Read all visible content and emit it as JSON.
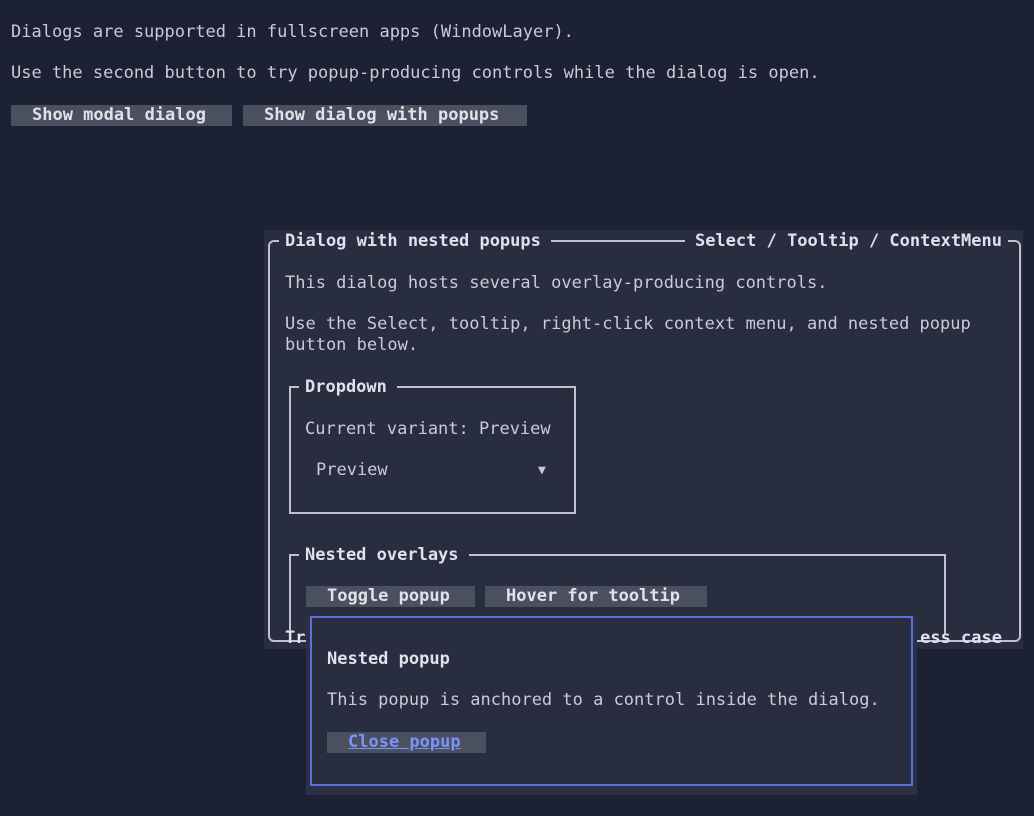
{
  "page": {
    "line1": "Dialogs are supported in fullscreen apps (WindowLayer).",
    "line2": "Use the second button to try popup-producing controls while the dialog is open.",
    "show_modal_label": "Show modal dialog",
    "show_popups_label": "Show dialog with popups"
  },
  "dialog": {
    "title": "Dialog with nested popups",
    "right_title": "Select / Tooltip / ContextMenu",
    "desc1": "This dialog hosts several overlay-producing controls.",
    "desc2a": "Use the Select, tooltip, right-click context menu, and nested popup",
    "desc2b": "button below.",
    "dropdown_group": "Dropdown",
    "current_variant": "Current variant: Preview",
    "select_value": "Preview",
    "nested_group": "Nested overlays",
    "toggle_popup_label": "Toggle popup",
    "tooltip_button_label": "Hover for tooltip",
    "bottom_left_fragment": "Tr",
    "bottom_right_fragment": "ess case"
  },
  "popup": {
    "title": "Nested popup",
    "body": "This popup is anchored to a control inside the dialog.",
    "close_label": "Close popup"
  },
  "colors": {
    "background": "#1c2133",
    "dialog": "#282d40",
    "accent": "#5b70d8",
    "link": "#7b93ff",
    "button": "#4b505e"
  }
}
